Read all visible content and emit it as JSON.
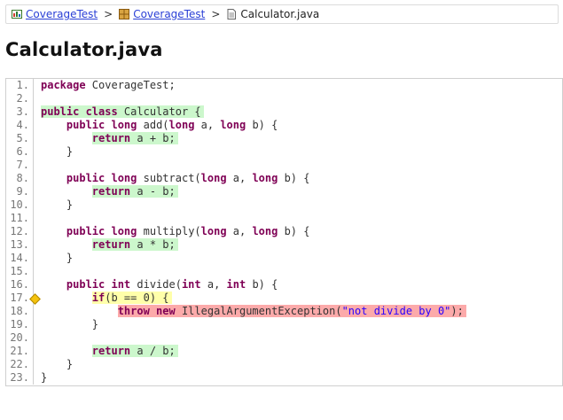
{
  "breadcrumb": {
    "items": [
      {
        "label": "CoverageTest",
        "icon": "report-icon"
      },
      {
        "label": "CoverageTest",
        "icon": "package-icon"
      },
      {
        "label": "Calculator.java",
        "icon": "file-icon"
      }
    ],
    "separator": ">"
  },
  "page_title": "Calculator.java",
  "code": {
    "lines": [
      {
        "n": "1.",
        "indent": "",
        "cov": "",
        "tokens": [
          {
            "t": "kw",
            "v": "package"
          },
          {
            "t": "",
            "v": " CoverageTest;"
          }
        ]
      },
      {
        "n": "2.",
        "indent": "",
        "cov": "",
        "tokens": []
      },
      {
        "n": "3.",
        "indent": "",
        "cov": "fc",
        "tokens": [
          {
            "t": "kw",
            "v": "public class"
          },
          {
            "t": "",
            "v": " Calculator {"
          }
        ]
      },
      {
        "n": "4.",
        "indent": "    ",
        "cov": "",
        "tokens": [
          {
            "t": "kw",
            "v": "public long"
          },
          {
            "t": "",
            "v": " add("
          },
          {
            "t": "kw",
            "v": "long"
          },
          {
            "t": "",
            "v": " a, "
          },
          {
            "t": "kw",
            "v": "long"
          },
          {
            "t": "",
            "v": " b) {"
          }
        ]
      },
      {
        "n": "5.",
        "indent": "        ",
        "cov": "fc",
        "tokens": [
          {
            "t": "kw",
            "v": "return"
          },
          {
            "t": "",
            "v": " a + b;"
          }
        ]
      },
      {
        "n": "6.",
        "indent": "    ",
        "cov": "",
        "tokens": [
          {
            "t": "",
            "v": "}"
          }
        ]
      },
      {
        "n": "7.",
        "indent": "",
        "cov": "",
        "tokens": []
      },
      {
        "n": "8.",
        "indent": "    ",
        "cov": "",
        "tokens": [
          {
            "t": "kw",
            "v": "public long"
          },
          {
            "t": "",
            "v": " subtract("
          },
          {
            "t": "kw",
            "v": "long"
          },
          {
            "t": "",
            "v": " a, "
          },
          {
            "t": "kw",
            "v": "long"
          },
          {
            "t": "",
            "v": " b) {"
          }
        ]
      },
      {
        "n": "9.",
        "indent": "        ",
        "cov": "fc",
        "tokens": [
          {
            "t": "kw",
            "v": "return"
          },
          {
            "t": "",
            "v": " a - b;"
          }
        ]
      },
      {
        "n": "10.",
        "indent": "    ",
        "cov": "",
        "tokens": [
          {
            "t": "",
            "v": "}"
          }
        ]
      },
      {
        "n": "11.",
        "indent": "",
        "cov": "",
        "tokens": []
      },
      {
        "n": "12.",
        "indent": "    ",
        "cov": "",
        "tokens": [
          {
            "t": "kw",
            "v": "public long"
          },
          {
            "t": "",
            "v": " multiply("
          },
          {
            "t": "kw",
            "v": "long"
          },
          {
            "t": "",
            "v": " a, "
          },
          {
            "t": "kw",
            "v": "long"
          },
          {
            "t": "",
            "v": " b) {"
          }
        ]
      },
      {
        "n": "13.",
        "indent": "        ",
        "cov": "fc",
        "tokens": [
          {
            "t": "kw",
            "v": "return"
          },
          {
            "t": "",
            "v": " a * b;"
          }
        ]
      },
      {
        "n": "14.",
        "indent": "    ",
        "cov": "",
        "tokens": [
          {
            "t": "",
            "v": "}"
          }
        ]
      },
      {
        "n": "15.",
        "indent": "",
        "cov": "",
        "tokens": []
      },
      {
        "n": "16.",
        "indent": "    ",
        "cov": "",
        "tokens": [
          {
            "t": "kw",
            "v": "public int"
          },
          {
            "t": "",
            "v": " divide("
          },
          {
            "t": "kw",
            "v": "int"
          },
          {
            "t": "",
            "v": " a, "
          },
          {
            "t": "kw",
            "v": "int"
          },
          {
            "t": "",
            "v": " b) {"
          }
        ]
      },
      {
        "n": "17.",
        "indent": "        ",
        "cov": "pc",
        "branch": true,
        "tokens": [
          {
            "t": "kw",
            "v": "if"
          },
          {
            "t": "",
            "v": "(b == 0) {"
          }
        ]
      },
      {
        "n": "18.",
        "indent": "            ",
        "cov": "nc",
        "tokens": [
          {
            "t": "kw",
            "v": "throw new"
          },
          {
            "t": "",
            "v": " IllegalArgumentException("
          },
          {
            "t": "str",
            "v": "\"not divide by 0\""
          },
          {
            "t": "",
            "v": ");"
          }
        ]
      },
      {
        "n": "19.",
        "indent": "        ",
        "cov": "",
        "tokens": [
          {
            "t": "",
            "v": "}"
          }
        ]
      },
      {
        "n": "20.",
        "indent": "",
        "cov": "",
        "tokens": []
      },
      {
        "n": "21.",
        "indent": "        ",
        "cov": "fc",
        "tokens": [
          {
            "t": "kw",
            "v": "return"
          },
          {
            "t": "",
            "v": " a / b;"
          }
        ]
      },
      {
        "n": "22.",
        "indent": "    ",
        "cov": "",
        "tokens": [
          {
            "t": "",
            "v": "}"
          }
        ]
      },
      {
        "n": "23.",
        "indent": "",
        "cov": "",
        "tokens": [
          {
            "t": "",
            "v": "}"
          }
        ]
      }
    ]
  },
  "colors": {
    "covered": "#ccf7cc",
    "not_covered": "#fcaaaa",
    "partial": "#ffffaa",
    "keyword": "#7f0055",
    "string": "#2a00ff",
    "link": "#2a3fd6"
  }
}
